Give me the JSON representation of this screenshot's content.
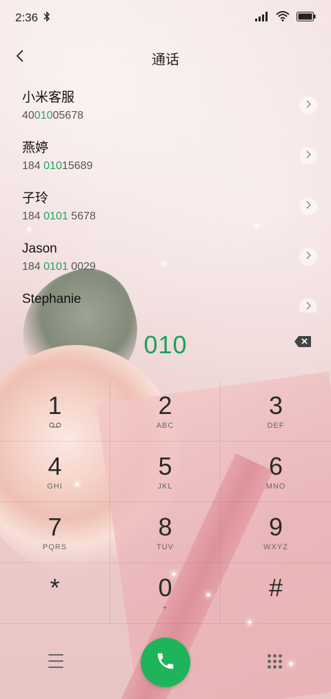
{
  "status_bar": {
    "time": "2:36",
    "icons": [
      "bluetooth-icon",
      "signal-icon",
      "wifi-icon",
      "battery-icon"
    ]
  },
  "header": {
    "title": "通话",
    "back_icon": "chevron-left-icon"
  },
  "contacts": [
    {
      "name": "小米客服",
      "num_pre": "40",
      "num_hl": "010",
      "num_post": "05678"
    },
    {
      "name": "燕婷",
      "num_pre": "184 ",
      "num_hl": "010",
      "num_post": "15689"
    },
    {
      "name": "子玲",
      "num_pre": "184 ",
      "num_hl": "0101",
      "num_post": " 5678"
    },
    {
      "name": "Jason",
      "num_pre": "184 ",
      "num_hl": "0101",
      "num_post": " 0029"
    },
    {
      "name": "Stephanie",
      "num_pre": "",
      "num_hl": "",
      "num_post": ""
    }
  ],
  "dialer": {
    "digits": "010",
    "delete_icon": "backspace-icon",
    "keys": [
      {
        "digit": "1",
        "letters": ""
      },
      {
        "digit": "2",
        "letters": "ABC"
      },
      {
        "digit": "3",
        "letters": "DEF"
      },
      {
        "digit": "4",
        "letters": "GHI"
      },
      {
        "digit": "5",
        "letters": "JKL"
      },
      {
        "digit": "6",
        "letters": "MNO"
      },
      {
        "digit": "7",
        "letters": "PQRS"
      },
      {
        "digit": "8",
        "letters": "TUV"
      },
      {
        "digit": "9",
        "letters": "WXYZ"
      },
      {
        "digit": "*",
        "letters": ""
      },
      {
        "digit": "0",
        "letters": "+"
      },
      {
        "digit": "#",
        "letters": ""
      }
    ]
  },
  "bottom_bar": {
    "menu_icon": "menu-icon",
    "call_icon": "phone-icon",
    "keypad_icon": "dialpad-icon"
  },
  "colors": {
    "accent_green": "#1aa25a",
    "call_button": "#1fb45c"
  }
}
